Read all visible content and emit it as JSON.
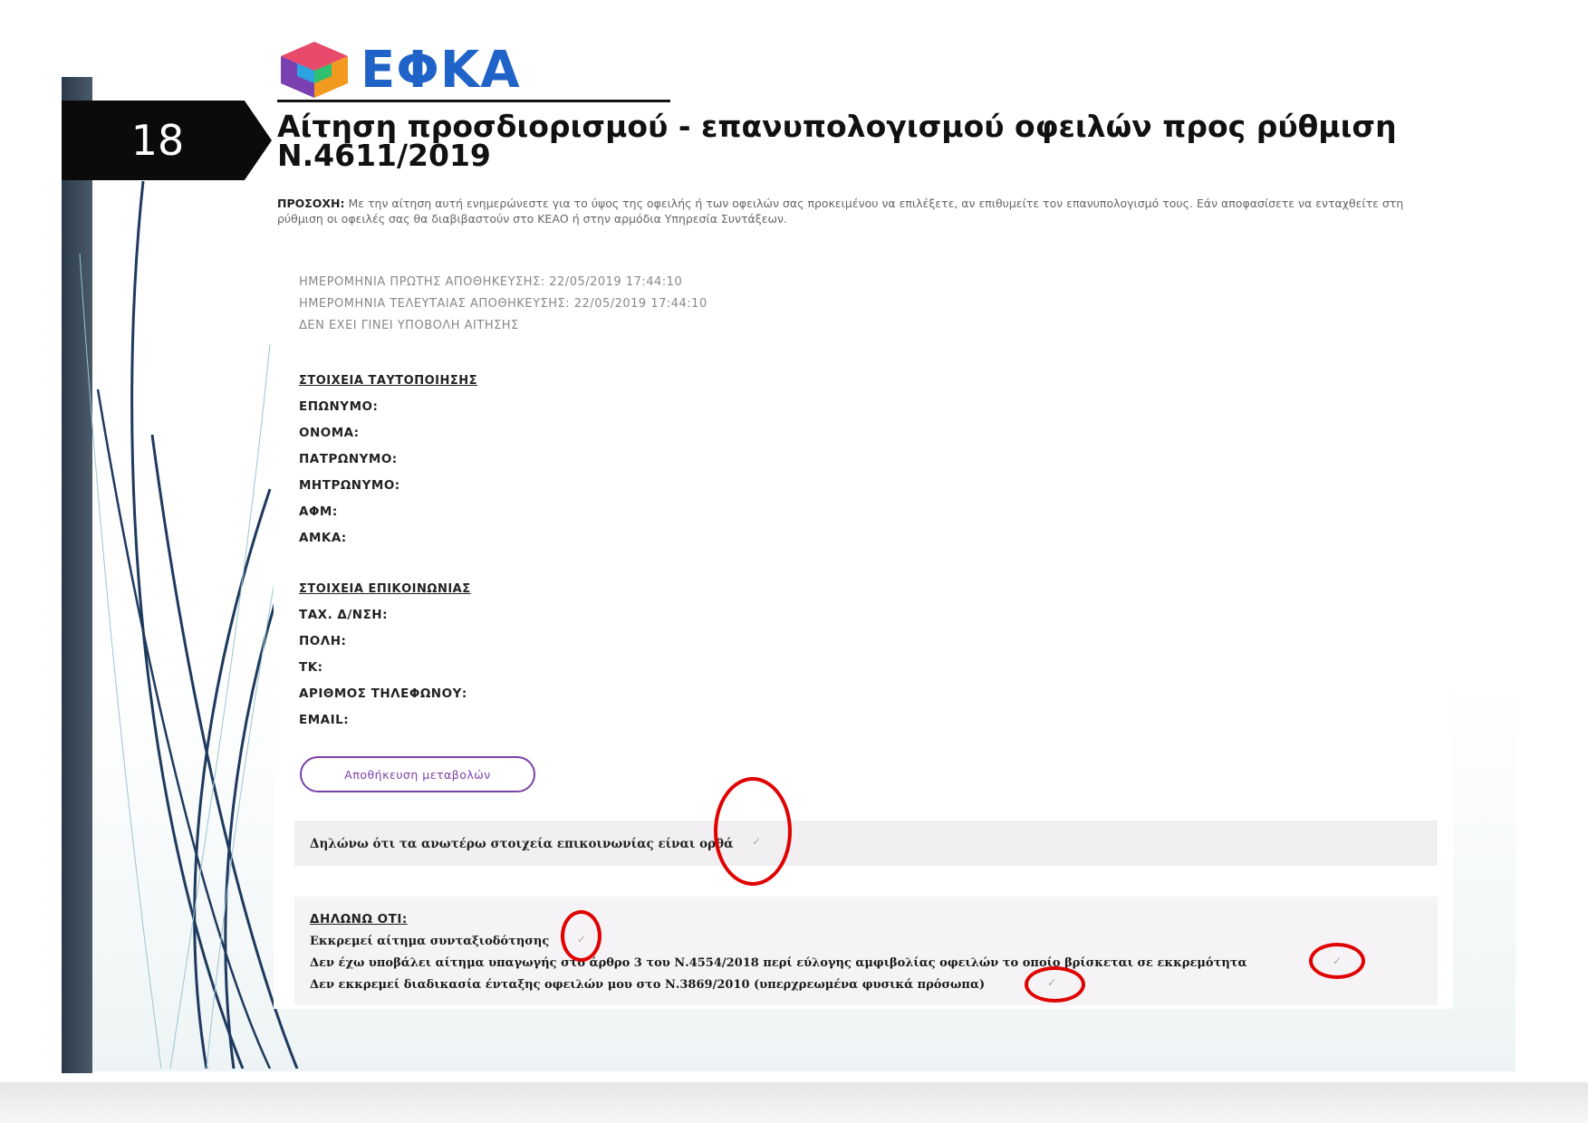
{
  "slide": {
    "number": "18",
    "logo_text": "ΕΦΚΑ",
    "title_line1": "Αίτηση προσδιορισμού - επανυπολογισμού οφειλών προς ρύθμιση",
    "title_line2": "Ν.4611/2019",
    "notice_label": "ΠΡΟΣΟΧΗ:",
    "notice_text": "Με την αίτηση αυτή ενημερώνεστε για το ύψος της οφειλής ή των οφειλών σας προκειμένου να επιλέξετε, αν επιθυμείτε τον επανυπολογισμό τους. Εάν αποφασίσετε να ενταχθείτε στη ρύθμιση οι οφειλές σας θα διαβιβαστούν στο ΚΕΑΟ ή στην αρμόδια Υπηρεσία Συντάξεων."
  },
  "form": {
    "meta": [
      "ΗΜΕΡΟΜΗΝΙΑ ΠΡΩΤΗΣ ΑΠΟΘΗΚΕΥΣΗΣ: 22/05/2019 17:44:10",
      "ΗΜΕΡΟΜΗΝΙΑ ΤΕΛΕΥΤΑΙΑΣ ΑΠΟΘΗΚΕΥΣΗΣ: 22/05/2019 17:44:10",
      "ΔΕΝ ΕΧΕΙ ΓΙΝΕΙ ΥΠΟΒΟΛΗ ΑΙΤΗΣΗΣ"
    ],
    "identity_heading": "ΣΤΟΙΧΕΙΑ ΤΑΥΤΟΠΟΙΗΣΗΣ",
    "identity_fields": [
      "ΕΠΩΝΥΜΟ:",
      "ΟΝΟΜΑ:",
      "ΠΑΤΡΩΝΥΜΟ:",
      "ΜΗΤΡΩΝΥΜΟ:",
      "ΑΦΜ:",
      "ΑΜΚΑ:"
    ],
    "contact_heading": "ΣΤΟΙΧΕΙΑ ΕΠΙΚΟΙΝΩΝΙΑΣ",
    "contact_fields": [
      "ΤΑΧ. Δ/ΝΣΗ:",
      "ΠΟΛΗ:",
      "ΤΚ:",
      "ΑΡΙΘΜΟΣ ΤΗΛΕΦΩΝΟΥ:",
      "EMAIL:"
    ],
    "save_label": "Αποθήκευση μεταβολών",
    "declare_contact": "Δηλώνω ότι τα ανωτέρω στοιχεία επικοινωνίας είναι ορθά",
    "declarations_heading": "ΔΗΛΩΝΩ ΟΤΙ:",
    "declarations": [
      "Εκκρεμεί αίτημα συνταξιοδότησης",
      "Δεν έχω υποβάλει αίτημα υπαγωγής στο άρθρο 3 του Ν.4554/2018 περί εύλογης αμφιβολίας οφειλών το οποίο βρίσκεται σε εκκρεμότητα",
      "Δεν εκκρεμεί διαδικασία ένταξης οφειλών μου στο Ν.3869/2010 (υπερχρεωμένα φυσικά πρόσωπα)"
    ],
    "check_glyph": "✓"
  },
  "colors": {
    "logo_blue": "#1f63c8",
    "button_purple": "#7b3fa8",
    "annotation_red": "#e00000"
  }
}
